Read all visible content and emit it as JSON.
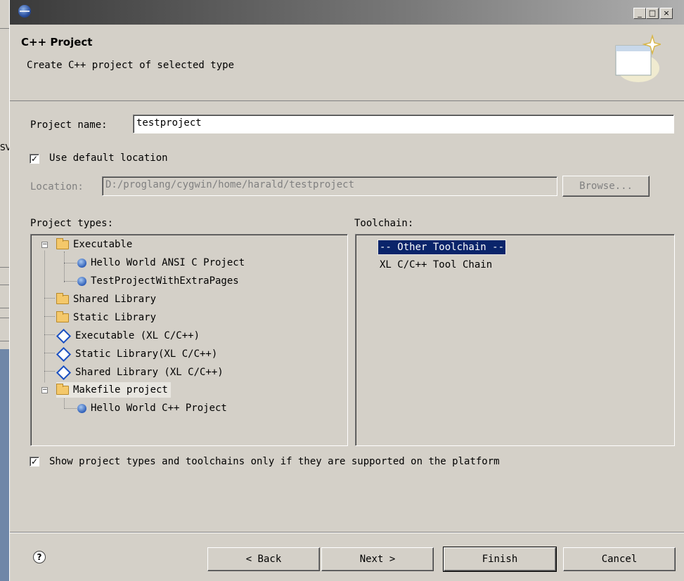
{
  "background": {
    "partial_label": "SV"
  },
  "window": {
    "title": "",
    "buttons": {
      "minimize": "_",
      "maximize": "□",
      "close": "×"
    }
  },
  "header": {
    "title": "C++ Project",
    "description": "Create C++ project of selected type"
  },
  "form": {
    "project_name_label": "Project name:",
    "project_name_value": "testproject",
    "use_default_location_label": "Use default location",
    "use_default_location_checked": true,
    "location_label": "Location:",
    "location_value": "D:/proglang/cygwin/home/harald/testproject",
    "browse_label": "Browse...",
    "project_types_label": "Project types:",
    "toolchain_label": "Toolchain:",
    "show_supported_label": "Show project types and toolchains only if they are supported on the platform",
    "show_supported_checked": true
  },
  "project_types": [
    {
      "label": "Executable",
      "icon": "folder-icon",
      "level": 0,
      "expander": "−"
    },
    {
      "label": "Hello World ANSI C Project",
      "icon": "project-template-icon",
      "level": 1
    },
    {
      "label": "TestProjectWithExtraPages",
      "icon": "project-template-icon",
      "level": 1
    },
    {
      "label": "Shared Library",
      "icon": "folder-icon",
      "level": 0
    },
    {
      "label": "Static Library",
      "icon": "folder-icon",
      "level": 0
    },
    {
      "label": "Executable (XL C/C++)",
      "icon": "diamond-icon",
      "level": 0
    },
    {
      "label": "Static Library(XL C/C++)",
      "icon": "diamond-icon",
      "level": 0
    },
    {
      "label": "Shared Library (XL C/C++)",
      "icon": "diamond-icon",
      "level": 0
    },
    {
      "label": "Makefile project",
      "icon": "folder-icon",
      "level": 0,
      "expander": "−"
    },
    {
      "label": "Hello World C++ Project",
      "icon": "project-template-icon",
      "level": 1
    }
  ],
  "toolchains": [
    {
      "label": "-- Other Toolchain --",
      "selected": true
    },
    {
      "label": "XL C/C++ Tool Chain",
      "selected": false
    }
  ],
  "footer": {
    "help_icon": "?",
    "back_label": "< Back",
    "next_label": "Next >",
    "finish_label": "Finish",
    "cancel_label": "Cancel"
  }
}
